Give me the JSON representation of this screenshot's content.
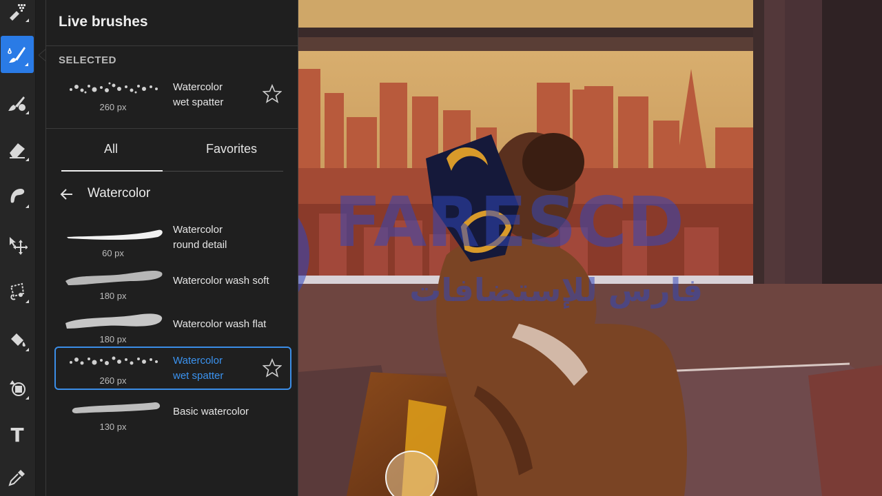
{
  "panel": {
    "title": "Live brushes",
    "selected_label": "SELECTED",
    "selected_brush": {
      "name_line1": "Watercolor",
      "name_line2": "wet spatter",
      "size": "260 px"
    },
    "tabs": [
      {
        "label": "All",
        "active": true
      },
      {
        "label": "Favorites",
        "active": false
      }
    ],
    "category": "Watercolor",
    "brushes": [
      {
        "name_line1": "Watercolor",
        "name_line2": "round detail",
        "size": "60 px",
        "selected": false
      },
      {
        "name_line1": "Watercolor wash soft",
        "name_line2": "",
        "size": "180 px",
        "selected": false
      },
      {
        "name_line1": "Watercolor wash flat",
        "name_line2": "",
        "size": "180 px",
        "selected": false
      },
      {
        "name_line1": "Watercolor",
        "name_line2": "wet spatter",
        "size": "260 px",
        "selected": true
      },
      {
        "name_line1": "Basic watercolor",
        "name_line2": "",
        "size": "130 px",
        "selected": false
      }
    ]
  },
  "toolbar": {
    "tools": [
      {
        "icon": "pixel-brush-icon",
        "active": false
      },
      {
        "icon": "live-brush-icon",
        "active": true
      },
      {
        "icon": "smudge-brush-icon",
        "active": false
      },
      {
        "icon": "eraser-icon",
        "active": false
      },
      {
        "icon": "healing-icon",
        "active": false
      },
      {
        "icon": "move-icon",
        "active": false
      },
      {
        "icon": "lasso-icon",
        "active": false
      },
      {
        "icon": "fill-icon",
        "active": false
      },
      {
        "icon": "transform-icon",
        "active": false
      },
      {
        "icon": "text-icon",
        "active": false
      },
      {
        "icon": "eyedropper-icon",
        "active": false
      }
    ],
    "text_tool_glyph": "T"
  },
  "watermark": {
    "latin": "FARESCD",
    "arabic": "فارس للإستضافات"
  },
  "colors": {
    "accent": "#2a7be6",
    "selected_text": "#3b93f0",
    "panel_bg": "#1f1f1f"
  }
}
